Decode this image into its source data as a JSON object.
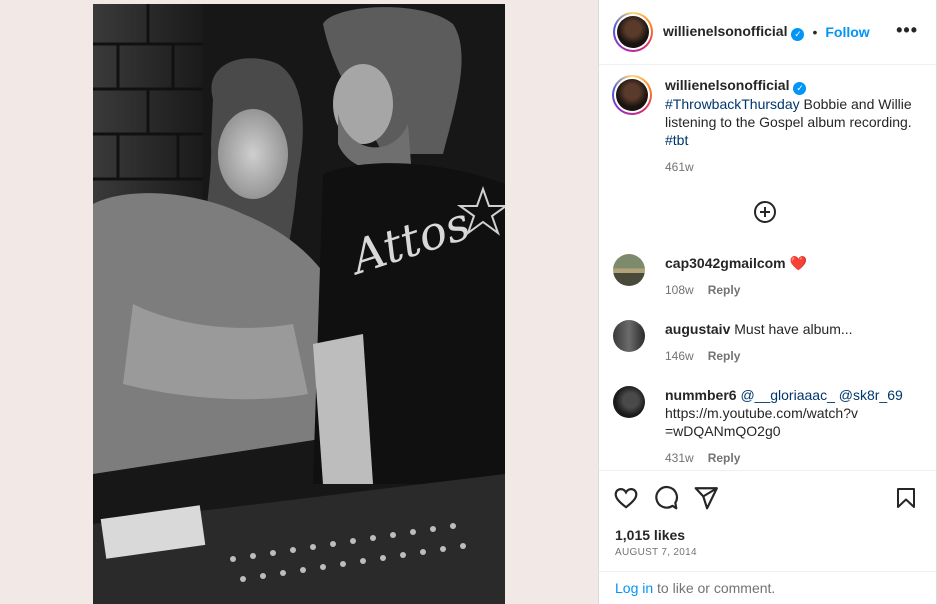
{
  "post": {
    "username": "willienelsonofficial",
    "verified_icon": "verified-badge-icon",
    "follow_label": "Follow",
    "more_icon": "more-options-icon",
    "more_label": "•••"
  },
  "caption": {
    "username": "willienelsonofficial",
    "hashtag1": "#ThrowbackThursday",
    "text": " Bobbie and Willie listening to the Gospel album recording. ",
    "hashtag2": "#tbt",
    "time": "461w"
  },
  "comments": [
    {
      "username": "cap3042gmailcom",
      "text": " ❤️",
      "time": "108w",
      "reply": "Reply"
    },
    {
      "username": "augustaiv",
      "text": " Must have album...",
      "time": "146w",
      "reply": "Reply"
    },
    {
      "username": "nummber6",
      "mention1": "@__gloriaaac_",
      "mention2": "@sk8r_69",
      "text": "https://m.youtube.com/watch?v=wDQANmQO2g0",
      "time": "431w",
      "reply": "Reply"
    }
  ],
  "actions": {
    "icons": [
      "heart-icon",
      "comment-icon",
      "share-icon",
      "bookmark-icon"
    ],
    "likes": "1,015 likes",
    "date": "AUGUST 7, 2014",
    "login_link": "Log in",
    "login_rest": " to like or comment."
  },
  "colors": {
    "accent": "#0095f6",
    "link": "#00376b",
    "muted": "#737373",
    "media_bg": "#f2e8e6"
  }
}
